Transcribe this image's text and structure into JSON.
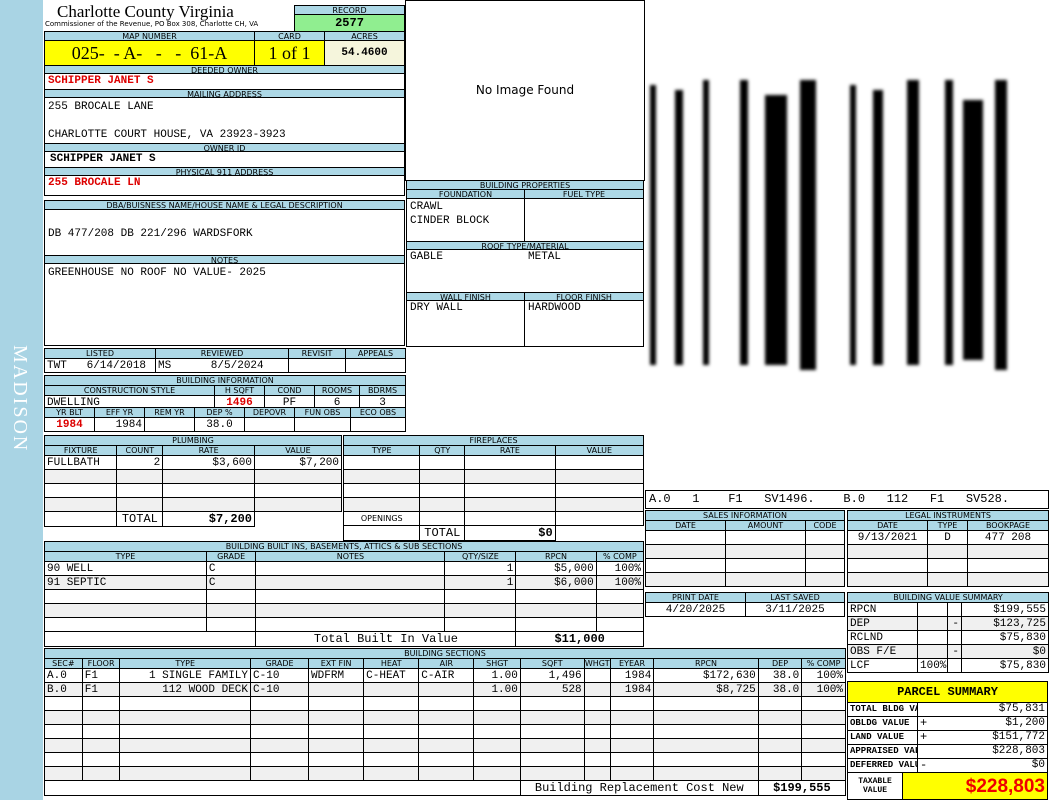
{
  "district": "MADISON",
  "header": {
    "title": "Charlotte County Virginia",
    "subtitle": "Commissioner of the Revenue, PO Box 308, Charlotte CH, VA",
    "record_label": "RECORD",
    "record": "2577"
  },
  "map": {
    "map_label": "MAP NUMBER",
    "map_number": "025-  - A-   -   -  61-A",
    "card_label": "CARD",
    "card": "1 of 1",
    "acres_label": "ACRES",
    "acres": "54.4600"
  },
  "owner": {
    "deeded_label": "DEEDED OWNER",
    "deeded": "SCHIPPER JANET S",
    "mailing_label": "MAILING ADDRESS",
    "mailing_line1": "255 BROCALE LANE",
    "mailing_line2": "CHARLOTTE COURT HOUSE, VA 23923-3923",
    "owner_id_label": "OWNER ID",
    "owner_id": "SCHIPPER JANET S",
    "physical_label": "PHYSICAL 911 ADDRESS",
    "physical": "255 BROCALE LN"
  },
  "dba": {
    "label": "DBA/BUISNESS NAME/HOUSE NAME & LEGAL DESCRIPTION",
    "value": "DB 477/208 DB 221/296 WARDSFORK"
  },
  "notes": {
    "label": "NOTES",
    "value": "GREENHOUSE NO ROOF NO VALUE- 2025"
  },
  "review": {
    "columns": [
      "LISTED",
      "REVIEWED",
      "REVISIT",
      "APPEALS"
    ],
    "rows": [
      [
        "TWT   6/14/2018",
        "MS      8/5/2024",
        "",
        ""
      ]
    ]
  },
  "building_info": {
    "title": "BUILDING INFORMATION",
    "columns": [
      "CONSTRUCTION STYLE",
      "H SQFT",
      "COND",
      "ROOMS",
      "BDRMS"
    ],
    "rows": [
      [
        "DWELLING",
        "1496",
        "PF",
        "6",
        "3"
      ]
    ],
    "columns2": [
      "YR BLT",
      "EFF YR",
      "REM YR",
      "DEP %",
      "DEPOVR",
      "FUN OBS",
      "ECO OBS"
    ],
    "rows2": [
      [
        "1984",
        "1984",
        "",
        "38.0",
        "",
        "",
        ""
      ]
    ]
  },
  "image": {
    "no_image": "No Image Found"
  },
  "building_properties": {
    "title": "BUILDING PROPERTIES",
    "foundation_label": "FOUNDATION",
    "foundation": "CRAWL\nCINDER BLOCK",
    "fuel_label": "FUEL TYPE",
    "fuel": "",
    "roof_label": "ROOF TYPE/MATERIAL",
    "roof_type": "GABLE",
    "roof_material": "METAL",
    "wall_label": "WALL FINISH",
    "wall": "DRY WALL",
    "floor_label": "FLOOR FINISH",
    "floor": "HARDWOOD"
  },
  "plumbing": {
    "title": "PLUMBING",
    "columns": [
      "FIXTURE",
      "COUNT",
      "RATE",
      "VALUE"
    ],
    "rows": [
      [
        "FULLBATH",
        "2",
        "$3,600",
        "$7,200"
      ]
    ],
    "total_label": "TOTAL",
    "total": "$7,200"
  },
  "fireplaces": {
    "title": "FIREPLACES",
    "columns": [
      "TYPE",
      "QTY",
      "RATE",
      "VALUE"
    ],
    "rows": [],
    "openings_label": "OPENINGS",
    "total_label": "TOTAL",
    "total": "$0"
  },
  "built_ins": {
    "title": "BUILDING BUILT INS, BASEMENTS, ATTICS & SUB SECTIONS",
    "columns": [
      "TYPE",
      "GRADE",
      "NOTES",
      "QTY/SIZE",
      "RPCN",
      "% COMP"
    ],
    "rows": [
      [
        "90 WELL",
        "C",
        "",
        "1",
        "$5,000",
        "100%"
      ],
      [
        "91 SEPTIC",
        "C",
        "",
        "1",
        "$6,000",
        "100%"
      ]
    ],
    "total_label": "Total Built In Value",
    "total": "$11,000"
  },
  "sections": {
    "title": "BUILDING SECTIONS",
    "columns": [
      "SEC#",
      "FLOOR",
      "TYPE",
      "GRADE",
      "EXT FIN",
      "HEAT",
      "AIR",
      "SHGT",
      "SQFT",
      "WHGT",
      "EYEAR",
      "RPCN",
      "DEP",
      "% COMP"
    ],
    "rows": [
      [
        "A.0",
        "F1",
        "1 SINGLE FAMILY",
        "C-10",
        "WDFRM",
        "C-HEAT",
        "C-AIR",
        "1.00",
        "1,496",
        "",
        "1984",
        "$172,630",
        "38.0",
        "100%"
      ],
      [
        "B.0",
        "F1",
        "112 WOOD DECK",
        "C-10",
        "",
        "",
        "",
        "1.00",
        "528",
        "",
        "1984",
        "$8,725",
        "38.0",
        "100%"
      ]
    ],
    "total_label": "Building Replacement Cost New",
    "total": "$199,555"
  },
  "sketch": {
    "caption": "A.0   1    F1   SV1496.    B.0   112   F1   SV528."
  },
  "sales": {
    "title": "SALES INFORMATION",
    "columns": [
      "DATE",
      "AMOUNT",
      "CODE"
    ],
    "rows": []
  },
  "legal": {
    "title": "LEGAL INSTRUMENTS",
    "columns": [
      "DATE",
      "TYPE",
      "BOOKPAGE"
    ],
    "rows": [
      [
        "9/13/2021",
        "D",
        "477 208"
      ]
    ]
  },
  "dates": {
    "columns": [
      "PRINT DATE",
      "LAST SAVED"
    ],
    "rows": [
      [
        "4/20/2025",
        "3/11/2025"
      ]
    ]
  },
  "value_summary": {
    "title": "BUILDING VALUE SUMMARY",
    "rows": [
      [
        "RPCN",
        "",
        "",
        "$199,555"
      ],
      [
        "DEP",
        "",
        "-",
        "$123,725"
      ],
      [
        "RCLND",
        "",
        "",
        "$75,830"
      ],
      [
        "OBS F/E",
        "",
        "-",
        "$0"
      ],
      [
        "LCF",
        "100%",
        "",
        "$75,830"
      ]
    ]
  },
  "parcel": {
    "title": "PARCEL SUMMARY",
    "rows": [
      [
        "TOTAL BLDG VALUE",
        "",
        "$75,831"
      ],
      [
        "OBLDG VALUE",
        "+",
        "$1,200"
      ],
      [
        "LAND VALUE",
        "+",
        "$151,772"
      ],
      [
        "APPRAISED VALUE",
        "",
        "$228,803"
      ],
      [
        "DEFERRED VALUE",
        "-",
        "$0"
      ]
    ],
    "taxable_label": "TAXABLE\nVALUE",
    "taxable": "$228,803"
  },
  "colors": {
    "header": "#add8e6",
    "highlight": "#ffff00",
    "record": "#90ee90",
    "alert": "#dd0000"
  }
}
